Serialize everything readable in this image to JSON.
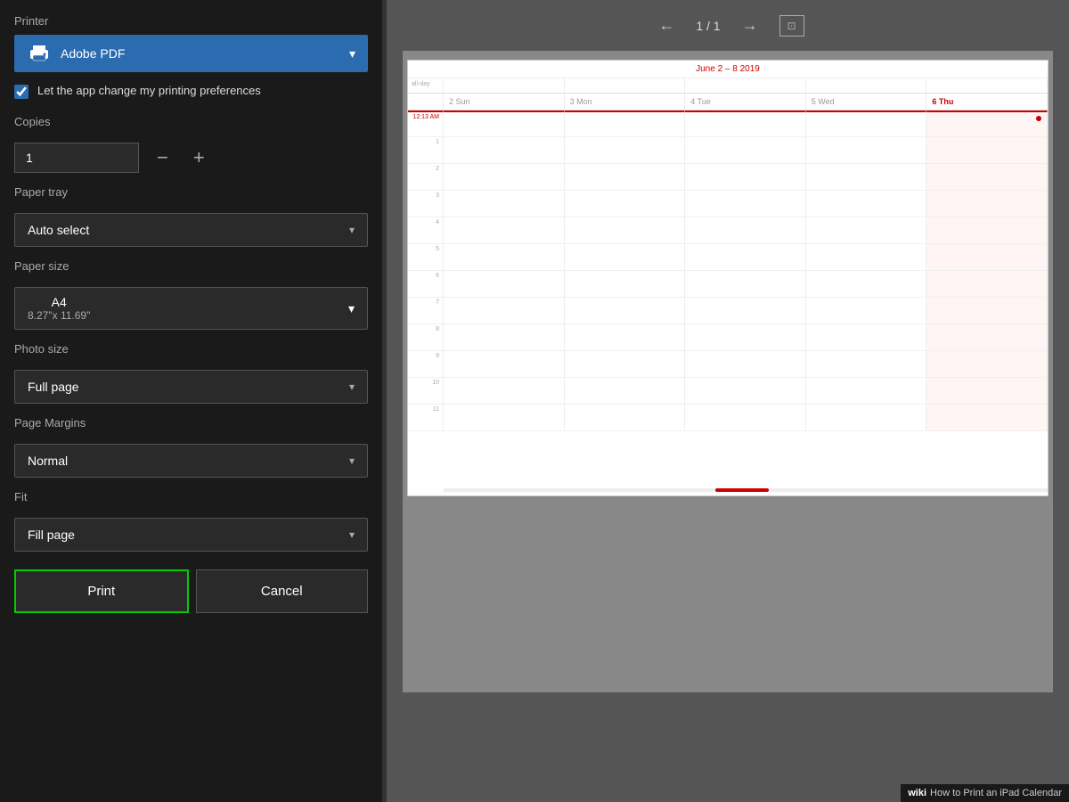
{
  "leftPanel": {
    "printerLabel": "Printer",
    "printerName": "Adobe PDF",
    "checkboxLabel": "Let the app change my printing preferences",
    "checkboxChecked": true,
    "copiesLabel": "Copies",
    "copiesValue": "1",
    "decrementBtn": "−",
    "incrementBtn": "+",
    "paperTrayLabel": "Paper tray",
    "paperTrayValue": "Auto select",
    "paperSizeLabel": "Paper size",
    "paperSizeMain": "A4",
    "paperSizeSub": "8.27\"x 11.69\"",
    "photoSizeLabel": "Photo size",
    "photoSizeValue": "Full page",
    "pageMarginsLabel": "Page Margins",
    "pageMarginsValue": "Normal",
    "fitLabel": "Fit",
    "fitValue": "Fill page",
    "printBtn": "Print",
    "cancelBtn": "Cancel"
  },
  "preview": {
    "pageIndicator": "1 / 1",
    "prevArrow": "←",
    "nextArrow": "→",
    "fitIcon": "⊡",
    "calendarHeader": "June 2 – 8 2019",
    "days": [
      {
        "label": "2 Sun",
        "today": false
      },
      {
        "label": "3 Mon",
        "today": false
      },
      {
        "label": "4 Tue",
        "today": false
      },
      {
        "label": "5 Wed",
        "today": false
      },
      {
        "label": "6 Thu",
        "today": true
      }
    ],
    "timeSlots": [
      "12:13 AM",
      "1",
      "2",
      "3",
      "4",
      "5",
      "6",
      "7",
      "8",
      "9",
      "10",
      "11"
    ],
    "alldayLabel": "all-day"
  },
  "watermark": {
    "wiki": "wiki",
    "rest": "How to Print an iPad Calendar"
  }
}
